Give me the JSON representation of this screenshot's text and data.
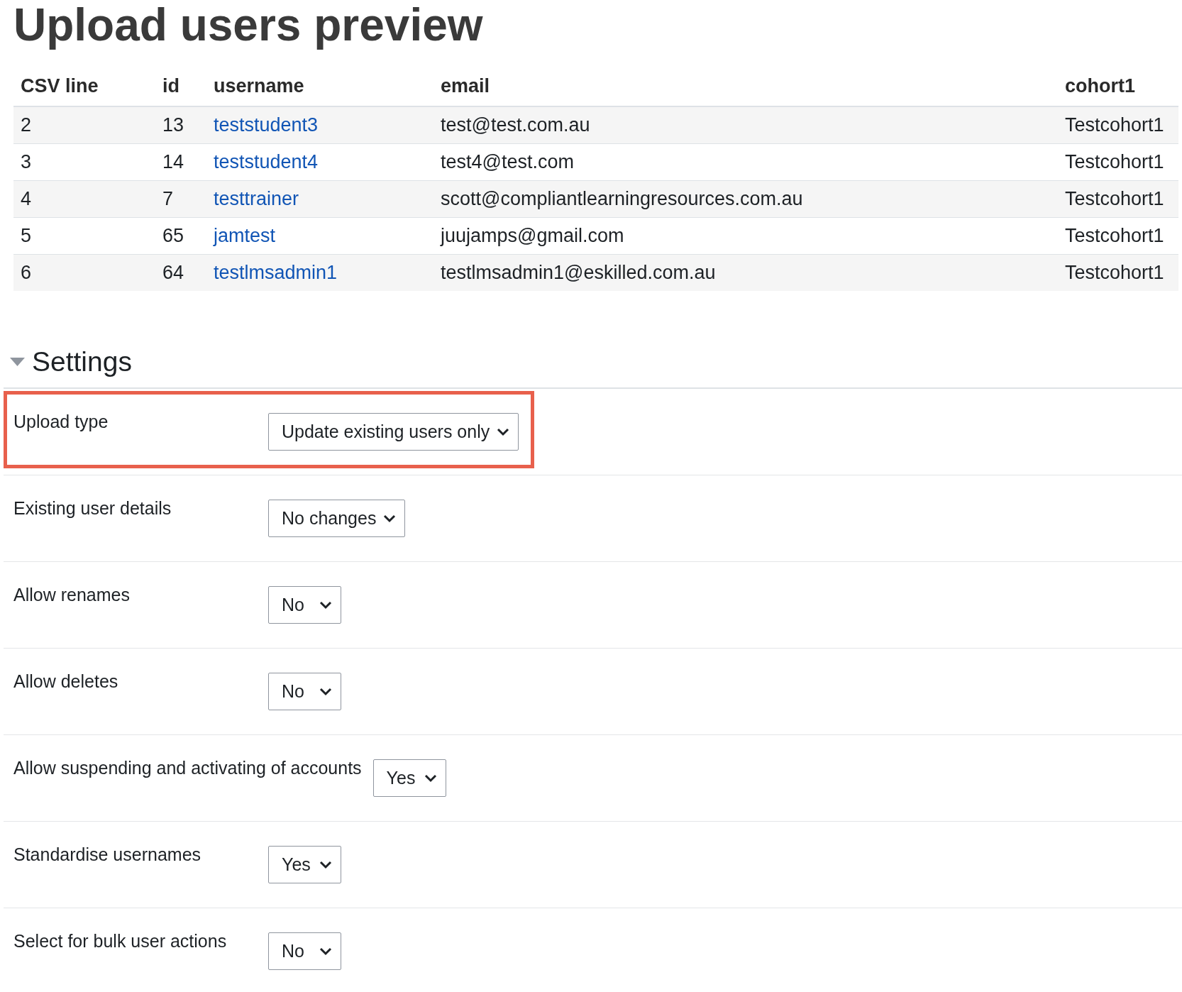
{
  "title": "Upload users preview",
  "table": {
    "columns": [
      "CSV line",
      "id",
      "username",
      "email",
      "cohort1"
    ],
    "rows": [
      {
        "csv_line": "2",
        "id": "13",
        "username": "teststudent3",
        "email": "test@test.com.au",
        "cohort1": "Testcohort1"
      },
      {
        "csv_line": "3",
        "id": "14",
        "username": "teststudent4",
        "email": "test4@test.com",
        "cohort1": "Testcohort1"
      },
      {
        "csv_line": "4",
        "id": "7",
        "username": "testtrainer",
        "email": "scott@compliantlearningresources.com.au",
        "cohort1": "Testcohort1"
      },
      {
        "csv_line": "5",
        "id": "65",
        "username": "jamtest",
        "email": "juujamps@gmail.com",
        "cohort1": "Testcohort1"
      },
      {
        "csv_line": "6",
        "id": "64",
        "username": "testlmsadmin1",
        "email": "testlmsadmin1@eskilled.com.au",
        "cohort1": "Testcohort1"
      }
    ]
  },
  "settings": {
    "heading": "Settings",
    "expanded": true,
    "fields": [
      {
        "label": "Upload type",
        "value": "Update existing users only",
        "highlighted": true
      },
      {
        "label": "Existing user details",
        "value": "No changes",
        "highlighted": false
      },
      {
        "label": "Allow renames",
        "value": "No",
        "highlighted": false
      },
      {
        "label": "Allow deletes",
        "value": "No",
        "highlighted": false
      },
      {
        "label": "Allow suspending and activating of accounts",
        "value": "Yes",
        "highlighted": false
      },
      {
        "label": "Standardise usernames",
        "value": "Yes",
        "highlighted": false
      },
      {
        "label": "Select for bulk user actions",
        "value": "No",
        "highlighted": false
      }
    ]
  }
}
